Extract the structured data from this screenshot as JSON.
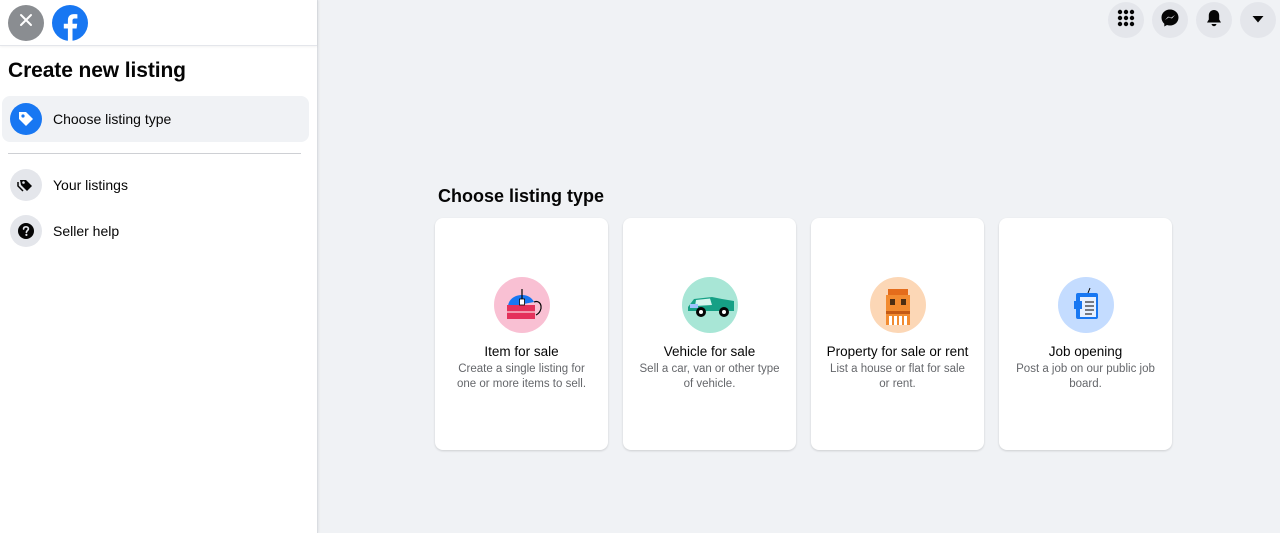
{
  "sidebar": {
    "title": "Create new listing",
    "items": [
      {
        "label": "Choose listing type",
        "icon": "tag-icon",
        "active": true
      },
      {
        "label": "Your listings",
        "icon": "tags-icon",
        "active": false
      },
      {
        "label": "Seller help",
        "icon": "question-icon",
        "active": false
      }
    ]
  },
  "main": {
    "title": "Choose listing type",
    "cards": [
      {
        "title": "Item for sale",
        "description": "Create a single listing for one or more items to sell.",
        "icon": "item-illustration-icon"
      },
      {
        "title": "Vehicle for sale",
        "description": "Sell a car, van or other type of vehicle.",
        "icon": "vehicle-illustration-icon"
      },
      {
        "title": "Property for sale or rent",
        "description": "List a house or flat for sale or rent.",
        "icon": "property-illustration-icon"
      },
      {
        "title": "Job opening",
        "description": "Post a job on our public job board.",
        "icon": "job-illustration-icon"
      }
    ]
  },
  "header": {
    "icons": [
      "menu-grid-icon",
      "messenger-icon",
      "notifications-bell-icon",
      "account-dropdown-icon"
    ]
  },
  "colors": {
    "brand": "#1877f2",
    "background": "#f0f2f5",
    "secondary_text": "#65676b"
  }
}
